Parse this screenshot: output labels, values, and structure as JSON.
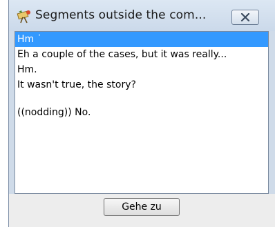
{
  "window": {
    "title": "Segments outside the com...",
    "title_icon": "exmaralda-app-icon",
    "close_icon": "close-x-icon"
  },
  "segments": [
    {
      "text": "Hm ˙",
      "selected": true
    },
    {
      "text": "Eh a couple of the cases, but it was really..."
    },
    {
      "text": "Hm."
    },
    {
      "text": "It wasn't true, the story?"
    },
    {
      "text": ""
    },
    {
      "text": "((nodding)) No."
    }
  ],
  "footer": {
    "goto_label": "Gehe zu"
  },
  "colors": {
    "selection": "#3399ff",
    "frame": "#cfdbe9"
  }
}
